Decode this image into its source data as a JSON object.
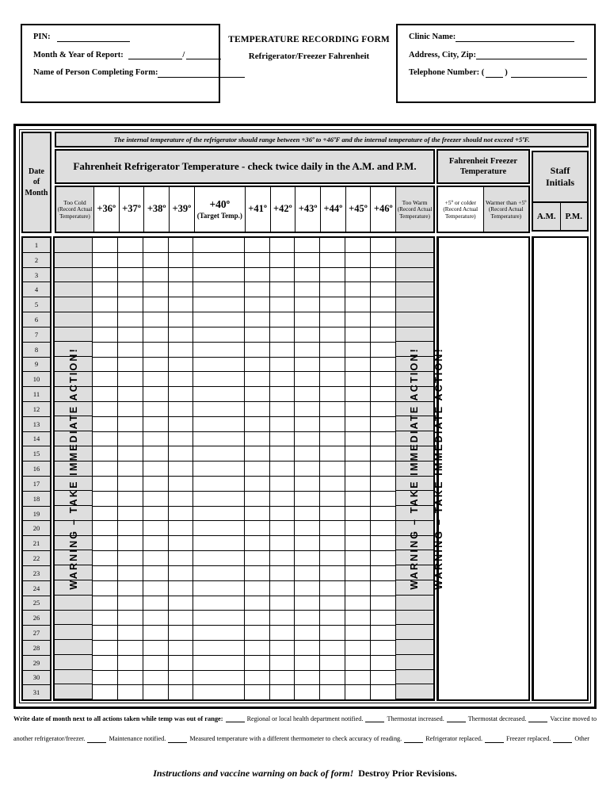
{
  "header": {
    "title_main": "TEMPERATURE RECORDING FORM",
    "title_sub": "Refrigerator/Freezer Fahrenheit",
    "left_box": {
      "pin_label": "PIN:",
      "month_year_label": "Month & Year of Report:",
      "month_year_separator": "/",
      "name_label": "Name of Person Completing Form:"
    },
    "right_box": {
      "clinic_label": "Clinic Name:",
      "address_label": "Address, City, Zip:",
      "telephone_label": "Telephone Number: (",
      "telephone_label_close": ")"
    }
  },
  "table": {
    "date_header": "Date\nof\nMonth",
    "date_header_lines": [
      "Date",
      "of",
      "Month"
    ],
    "note": "The internal temperature of the refrigerator should range between +36º to +46ºF and the internal temperature of the freezer should not exceed +5ºF.",
    "fridge_title": "Fahrenheit Refrigerator Temperature - check twice daily in the A.M. and P.M.",
    "freezer_title_lines": [
      "Fahrenheit Freezer",
      "Temperature"
    ],
    "staff_title_lines": [
      "Staff",
      "Initials"
    ],
    "staff_subcolumns": [
      "A.M.",
      "P.M."
    ],
    "record_actual_line1": "(Record Actual",
    "record_actual_line2": "Temperature)",
    "fridge_columns": [
      {
        "key": "too-cold",
        "label": "Too Cold",
        "type": "record",
        "shaded": true,
        "width": 58
      },
      {
        "key": "36",
        "label": "+36º",
        "type": "degree",
        "shaded": false,
        "width": 38
      },
      {
        "key": "37",
        "label": "+37º",
        "type": "degree",
        "shaded": false,
        "width": 38
      },
      {
        "key": "38",
        "label": "+38º",
        "type": "degree",
        "shaded": false,
        "width": 38
      },
      {
        "key": "39",
        "label": "+39º",
        "type": "degree",
        "shaded": false,
        "width": 38
      },
      {
        "key": "40",
        "label": "+40º",
        "sublabel": "(Target Temp.)",
        "type": "target",
        "shaded": false,
        "width": 78
      },
      {
        "key": "41",
        "label": "+41º",
        "type": "degree",
        "shaded": false,
        "width": 38
      },
      {
        "key": "42",
        "label": "+42º",
        "type": "degree",
        "shaded": false,
        "width": 38
      },
      {
        "key": "43",
        "label": "+43º",
        "type": "degree",
        "shaded": false,
        "width": 38
      },
      {
        "key": "44",
        "label": "+44º",
        "type": "degree",
        "shaded": false,
        "width": 38
      },
      {
        "key": "45",
        "label": "+45º",
        "type": "degree",
        "shaded": false,
        "width": 38
      },
      {
        "key": "46",
        "label": "+46º",
        "type": "degree",
        "shaded": false,
        "width": 38
      },
      {
        "key": "too-warm",
        "label": "Too Warm",
        "type": "record",
        "shaded": true,
        "width": 58
      }
    ],
    "freezer_columns": [
      {
        "key": "five-or-colder",
        "label": "+5º or colder",
        "type": "record",
        "shaded": false
      },
      {
        "key": "warmer-than-five",
        "label": "Warmer than +5º",
        "type": "record",
        "shaded": true
      }
    ],
    "warning_text": "WARNING – TAKE IMMEDIATE ACTION!",
    "dates": [
      1,
      2,
      3,
      4,
      5,
      6,
      7,
      8,
      9,
      10,
      11,
      12,
      13,
      14,
      15,
      16,
      17,
      18,
      19,
      20,
      21,
      22,
      23,
      24,
      25,
      26,
      27,
      28,
      29,
      30,
      31
    ]
  },
  "footer": {
    "line1_strong": "Write date of month next to all actions taken while temp was out of range:",
    "line1_items": [
      "Regional or local health department notified.",
      "Thermostat increased.",
      "Thermostat decreased.",
      "Vaccine moved to"
    ],
    "line2_lead": "another refrigerator/freezer.",
    "line2_items": [
      "Maintenance notified.",
      "Measured temperature with a different thermometer to check accuracy of reading.",
      "Refrigerator replaced.",
      "Freezer replaced.",
      "Other"
    ],
    "bottom_italic": "Instructions and vaccine warning on back of form!",
    "bottom_bold": "Destroy Prior Revisions."
  },
  "colors": {
    "shaded": "#dedede",
    "border": "#000000",
    "background": "#ffffff"
  }
}
